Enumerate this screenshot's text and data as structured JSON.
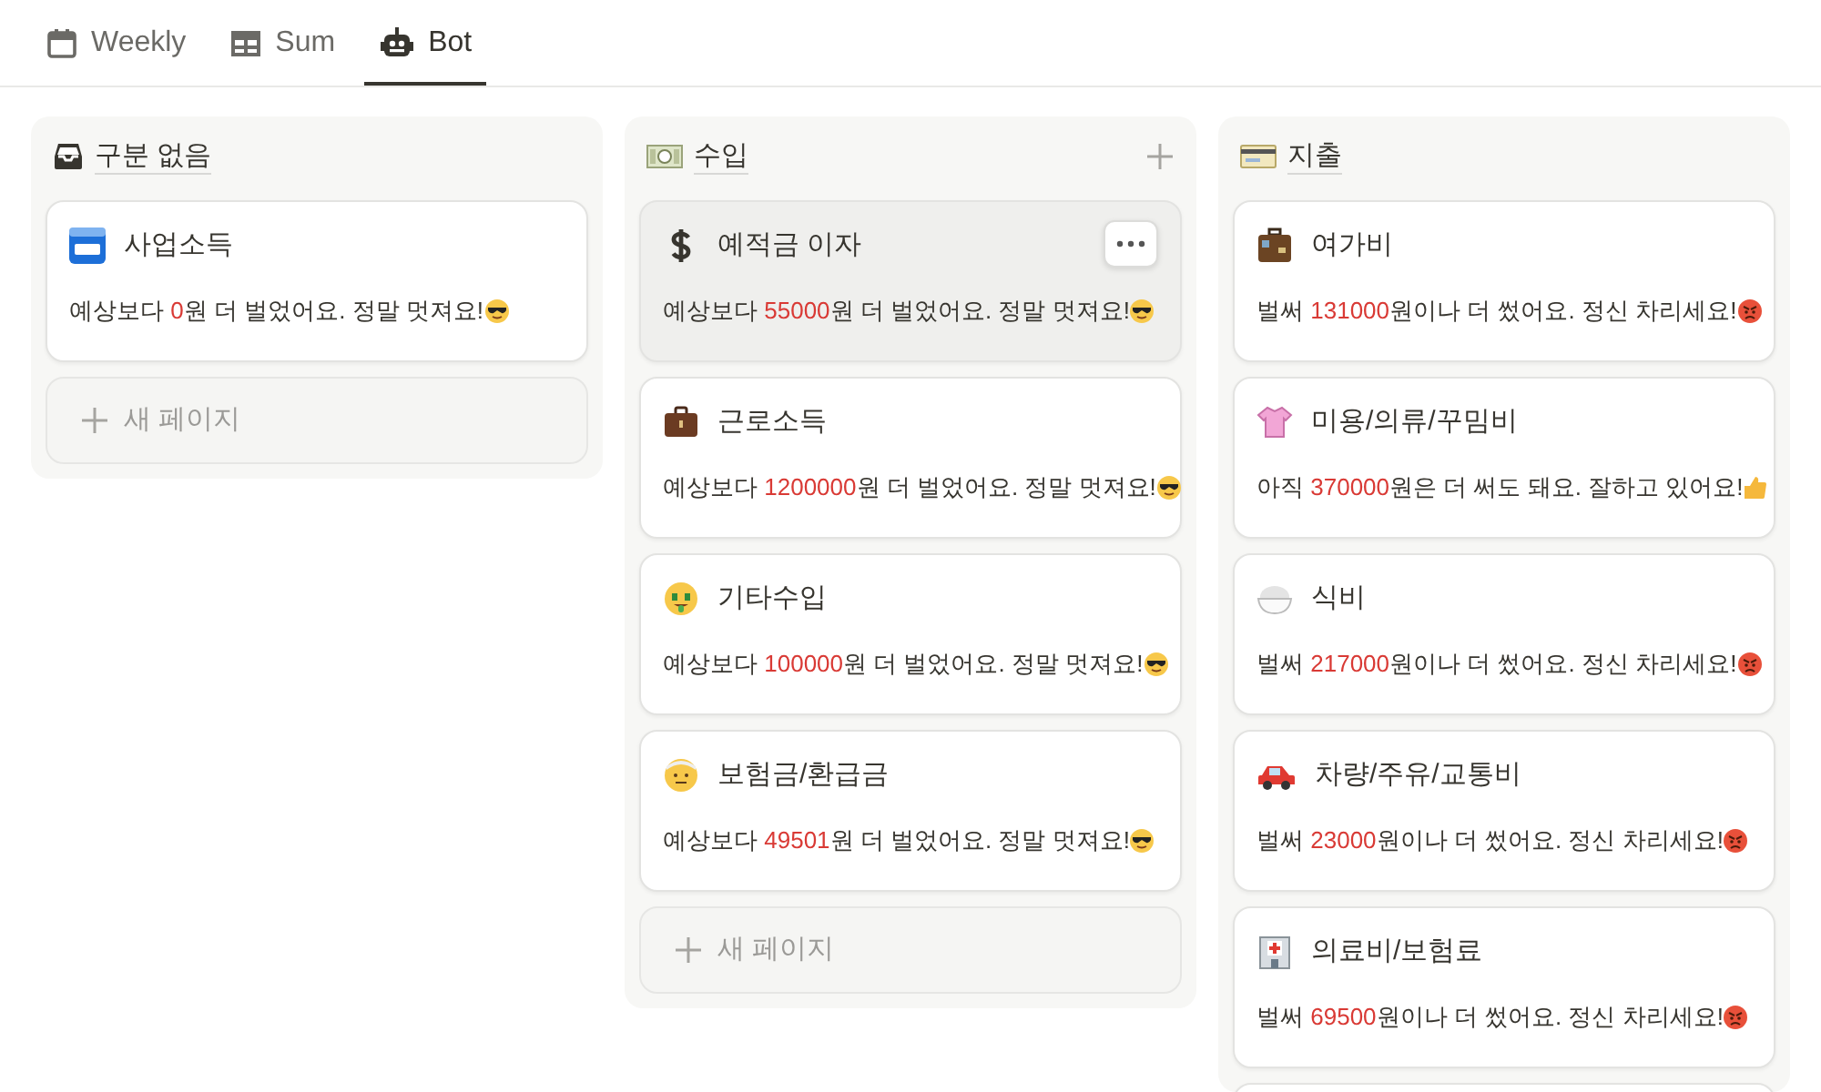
{
  "tabs": [
    {
      "label": "Weekly",
      "selected": false
    },
    {
      "label": "Sum",
      "selected": false
    },
    {
      "label": "Bot",
      "selected": true
    }
  ],
  "columns": [
    {
      "title": "구분 없음",
      "add_button": false,
      "new_page": "새 페이지",
      "cards": [
        {
          "title": "사업소득",
          "hovered": false,
          "message": {
            "before": "예상보다 ",
            "amount": "0",
            "after": "원 더 벌었어요. 정말 멋져요!",
            "kind": "earned"
          }
        }
      ]
    },
    {
      "title": "수입",
      "add_button": true,
      "new_page": "새 페이지",
      "cards": [
        {
          "title": "예적금 이자",
          "hovered": true,
          "message": {
            "before": "예상보다 ",
            "amount": "55000",
            "after": "원 더 벌었어요. 정말 멋져요!",
            "kind": "earned"
          }
        },
        {
          "title": "근로소득",
          "hovered": false,
          "message": {
            "before": "예상보다 ",
            "amount": "1200000",
            "after": "원 더 벌었어요. 정말 멋져요!",
            "kind": "earned"
          }
        },
        {
          "title": "기타수입",
          "hovered": false,
          "message": {
            "before": "예상보다 ",
            "amount": "100000",
            "after": "원 더 벌었어요. 정말 멋져요!",
            "kind": "earned"
          }
        },
        {
          "title": "보험금/환급금",
          "hovered": false,
          "message": {
            "before": "예상보다 ",
            "amount": "49501",
            "after": "원 더 벌었어요. 정말 멋져요!",
            "kind": "earned"
          }
        }
      ]
    },
    {
      "title": "지출",
      "add_button": false,
      "cards": [
        {
          "title": "여가비",
          "hovered": false,
          "message": {
            "before": "벌써 ",
            "amount": "131000",
            "after": "원이나 더 썼어요. 정신 차리세요!",
            "kind": "overspent"
          }
        },
        {
          "title": "미용/의류/꾸밈비",
          "hovered": false,
          "message": {
            "before": "아직 ",
            "amount": "370000",
            "after": "원은 더 써도 돼요. 잘하고 있어요!",
            "kind": "under_budget"
          }
        },
        {
          "title": "식비",
          "hovered": false,
          "message": {
            "before": "벌써 ",
            "amount": "217000",
            "after": "원이나 더 썼어요. 정신 차리세요!",
            "kind": "overspent"
          }
        },
        {
          "title": "차량/주유/교통비",
          "hovered": false,
          "message": {
            "before": "벌써 ",
            "amount": "23000",
            "after": "원이나 더 썼어요. 정신 차리세요!",
            "kind": "overspent"
          }
        },
        {
          "title": "의료비/보험료",
          "hovered": false,
          "message": {
            "before": "벌써 ",
            "amount": "69500",
            "after": "원이나 더 썼어요. 정신 차리세요!",
            "kind": "overspent"
          }
        },
        {
          "hovered": false
        }
      ]
    }
  ]
}
